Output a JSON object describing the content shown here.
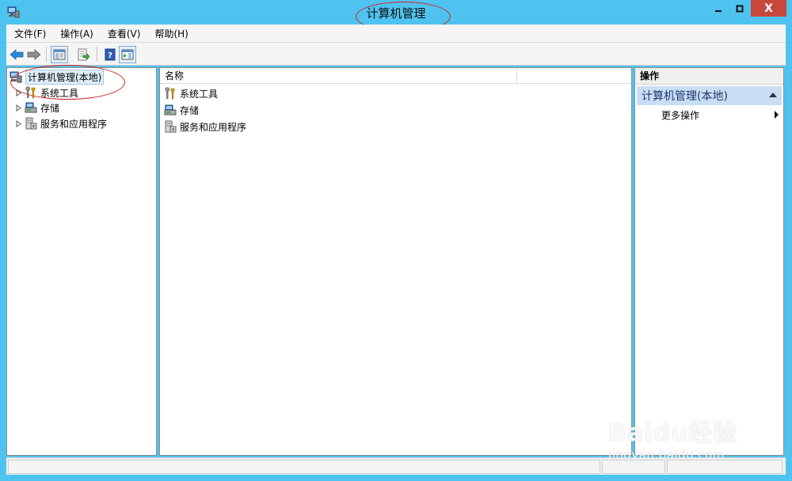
{
  "window": {
    "title": "计算机管理",
    "close_glyph": "X",
    "icon": "computer-management-icon"
  },
  "menu": [
    {
      "label": "文件(F)"
    },
    {
      "label": "操作(A)"
    },
    {
      "label": "查看(V)"
    },
    {
      "label": "帮助(H)"
    }
  ],
  "toolbar": {
    "buttons": [
      "back-arrow-icon",
      "forward-arrow-icon",
      "show-hide-console-tree-icon",
      "export-list-icon",
      "help-icon",
      "show-hide-action-pane-icon"
    ]
  },
  "tree": {
    "root": "计算机管理(本地)",
    "items": [
      {
        "label": "系统工具",
        "icon": "system-tools-icon"
      },
      {
        "label": "存储",
        "icon": "storage-icon"
      },
      {
        "label": "服务和应用程序",
        "icon": "services-apps-icon"
      }
    ]
  },
  "list": {
    "column_name": "名称",
    "rows": [
      {
        "label": "系统工具",
        "icon": "system-tools-icon"
      },
      {
        "label": "存储",
        "icon": "storage-icon"
      },
      {
        "label": "服务和应用程序",
        "icon": "services-apps-icon"
      }
    ]
  },
  "actions": {
    "header": "操作",
    "section": "计算机管理(本地)",
    "items": [
      {
        "label": "更多操作"
      }
    ]
  },
  "watermark": {
    "main": "Baidu经验",
    "sub": "jingyan.baidu.com"
  },
  "colors": {
    "frame": "#4fc3f0",
    "close_button": "#c7483b",
    "annotation": "#d02020",
    "selection": "#c9def5"
  }
}
